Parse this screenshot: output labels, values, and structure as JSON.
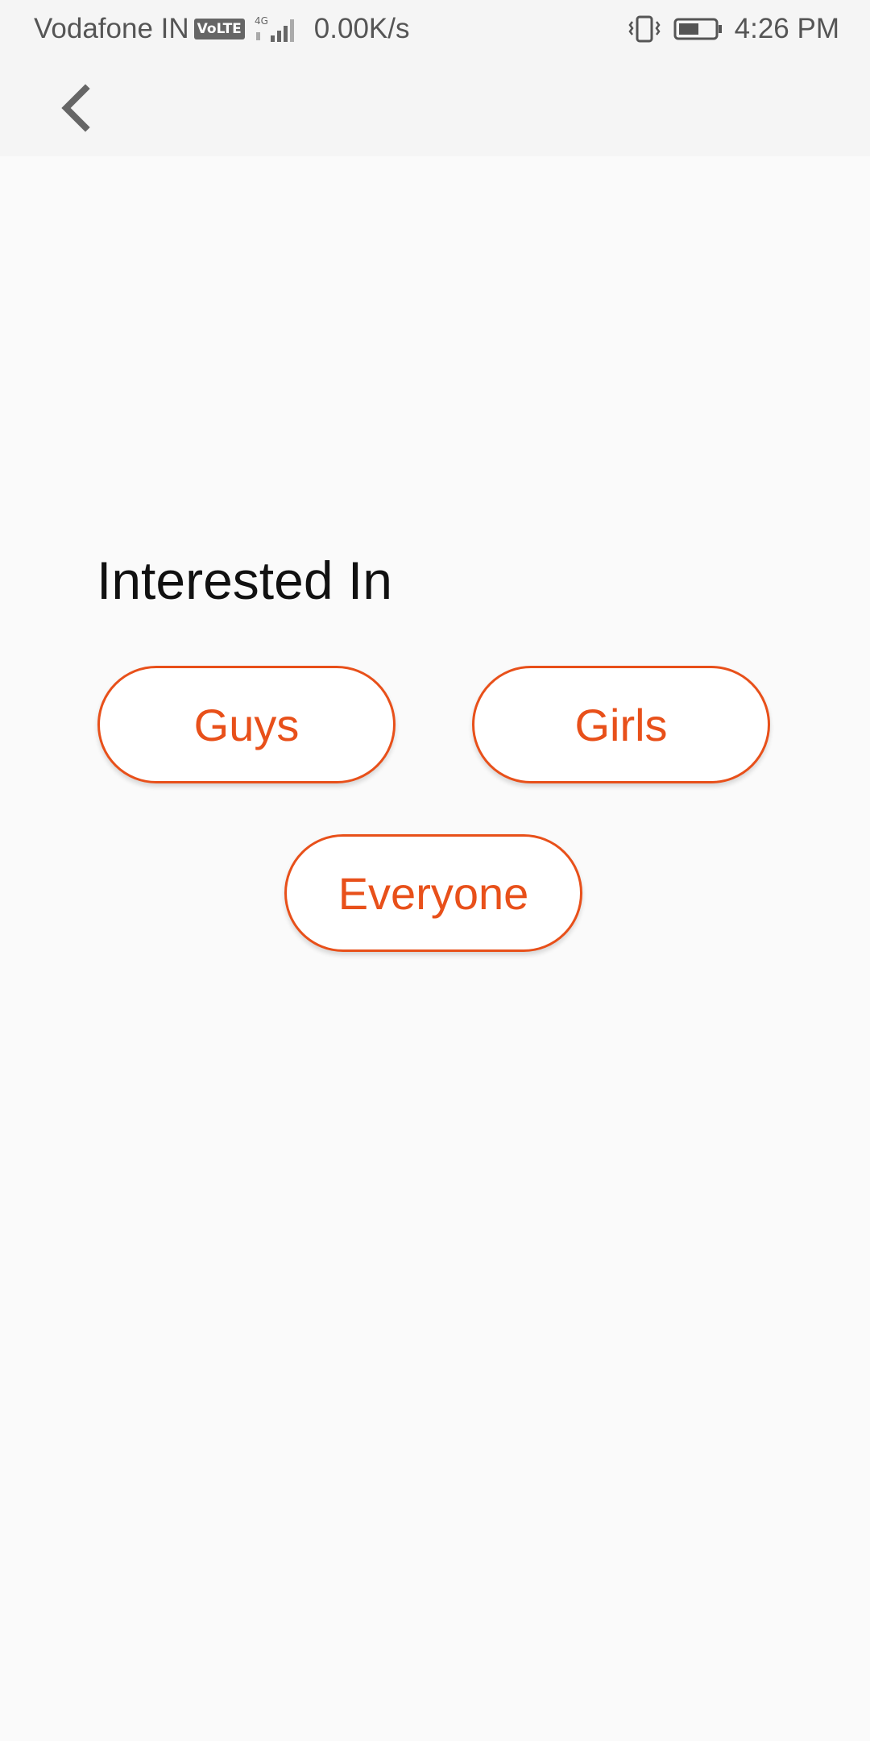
{
  "status_bar": {
    "carrier": "Vodafone IN",
    "volte": "VoLTE",
    "network_type": "4G",
    "net_speed": "0.00K/s",
    "time": "4:26 PM",
    "icons": [
      "signal-icon",
      "vibrate-icon",
      "battery-icon"
    ]
  },
  "toolbar": {
    "back_icon": "chevron-left-icon"
  },
  "main": {
    "title": "Interested In",
    "options": [
      {
        "label": "Guys"
      },
      {
        "label": "Girls"
      },
      {
        "label": "Everyone"
      }
    ]
  },
  "colors": {
    "accent": "#e8501a",
    "background": "#fafafa",
    "toolbar_background": "#f5f5f5",
    "title_text": "#111111"
  }
}
